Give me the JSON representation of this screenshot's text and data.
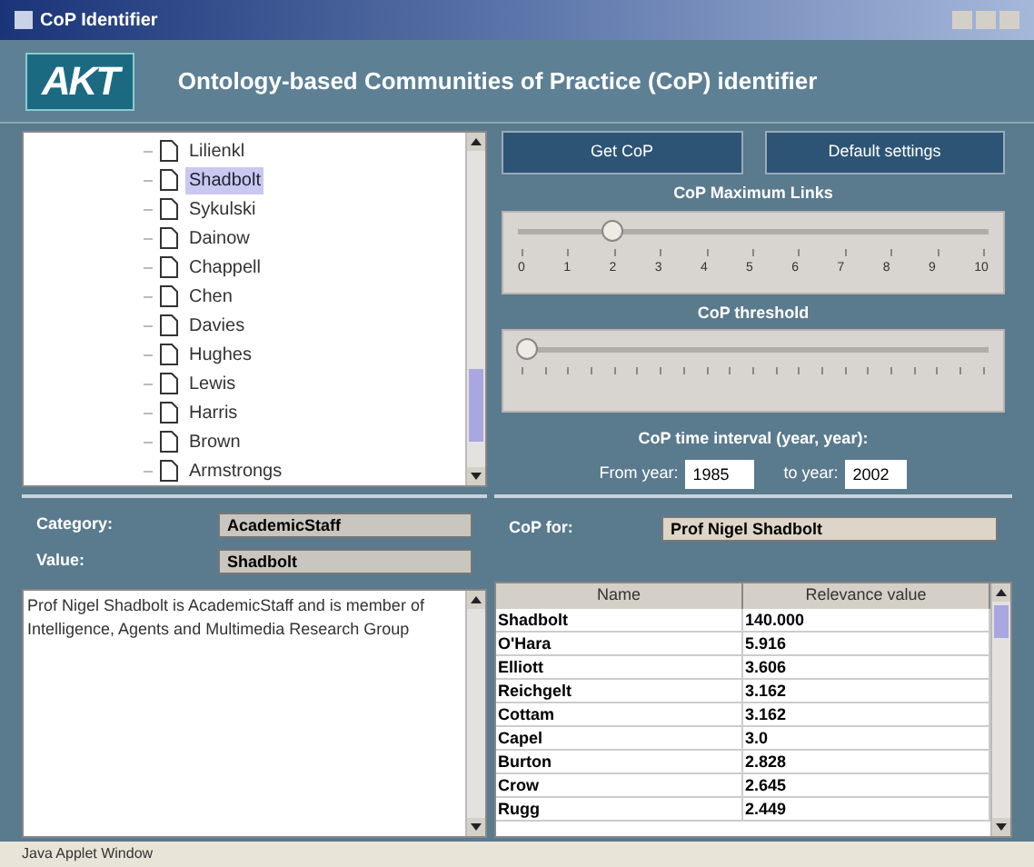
{
  "window": {
    "title": "CoP Identifier"
  },
  "header": {
    "logo": "AKT",
    "title": "Ontology-based Communities of Practice (CoP) identifier"
  },
  "tree": {
    "items": [
      {
        "label": "Lilienkl",
        "selected": false
      },
      {
        "label": "Shadbolt",
        "selected": true
      },
      {
        "label": "Sykulski",
        "selected": false
      },
      {
        "label": "Dainow",
        "selected": false
      },
      {
        "label": "Chappell",
        "selected": false
      },
      {
        "label": "Chen",
        "selected": false
      },
      {
        "label": "Davies",
        "selected": false
      },
      {
        "label": "Hughes",
        "selected": false
      },
      {
        "label": "Lewis",
        "selected": false
      },
      {
        "label": "Harris",
        "selected": false
      },
      {
        "label": "Brown",
        "selected": false
      },
      {
        "label": "Armstrongs",
        "selected": false
      }
    ]
  },
  "buttons": [
    "Get CoP",
    "Default settings"
  ],
  "sliders": [
    {
      "label": "CoP Maximum Links",
      "level": 0.2,
      "ticks": [
        "0",
        "1",
        "2",
        "3",
        "4",
        "5",
        "6",
        "7",
        "8",
        "9",
        "10"
      ]
    },
    {
      "label": "CoP threshold",
      "level": 0.02
    }
  ],
  "time_interval": {
    "label": "CoP time interval (year, year):",
    "from_label": "From year:",
    "from_value": "1985",
    "to_label": "to year:",
    "to_value": "2002"
  },
  "details": {
    "category_label": "Category:",
    "category_value": "AcademicStaff",
    "value_label": "Value:",
    "value_value": "Shadbolt",
    "description": "Prof Nigel Shadbolt is AcademicStaff and is member of Intelligence, Agents and Multimedia Research Group"
  },
  "result": {
    "for_label": "CoP for:",
    "for_value": "Prof Nigel Shadbolt",
    "columns": [
      "Name",
      "Relevance value"
    ],
    "rows": [
      [
        "Shadbolt",
        "140.000"
      ],
      [
        "O'Hara",
        "5.916"
      ],
      [
        "Elliott",
        "3.606"
      ],
      [
        "Reichgelt",
        "3.162"
      ],
      [
        "Cottam",
        "3.162"
      ],
      [
        "Capel",
        "3.0"
      ],
      [
        "Burton",
        "2.828"
      ],
      [
        "Crow",
        "2.645"
      ],
      [
        "Rugg",
        "2.449"
      ]
    ]
  },
  "status_bar": "Java Applet Window"
}
